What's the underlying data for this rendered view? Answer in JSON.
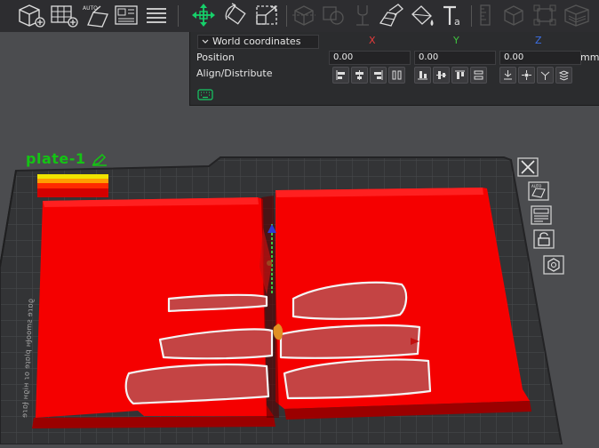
{
  "toolbar": {
    "tools": [
      {
        "name": "add-cube-icon"
      },
      {
        "name": "grid-arrange-icon"
      },
      {
        "name": "auto-orient-icon",
        "label": "AUTO"
      },
      {
        "name": "plate-layout-icon"
      },
      {
        "name": "list-objects-icon"
      },
      {
        "name": "move-icon"
      },
      {
        "name": "rotate-icon"
      },
      {
        "name": "scale-icon"
      },
      {
        "name": "cut-icon"
      },
      {
        "name": "mesh-boolean-icon"
      },
      {
        "name": "support-paint-icon"
      },
      {
        "name": "seam-paint-icon"
      },
      {
        "name": "color-paint-icon"
      },
      {
        "name": "text-icon"
      },
      {
        "name": "measure-icon"
      },
      {
        "name": "assembly-icon"
      },
      {
        "name": "brim-ears-icon"
      },
      {
        "name": "layers-icon"
      }
    ]
  },
  "gizmo": {
    "coord_label": "World coordinates",
    "axes": [
      {
        "label": "X",
        "color": "#e53b3b"
      },
      {
        "label": "Y",
        "color": "#3fc43f"
      },
      {
        "label": "Z",
        "color": "#3b6fe5"
      }
    ],
    "position_label": "Position",
    "position_values": [
      "0.00",
      "0.00",
      "0.00"
    ],
    "unit": "mm",
    "align_label": "Align/Distribute"
  },
  "plate": {
    "label": "plate-1"
  },
  "side_tools": [
    {
      "name": "close-plate-icon"
    },
    {
      "name": "auto-arrange-plate-icon"
    },
    {
      "name": "plate-settings-icon"
    },
    {
      "name": "lock-plate-icon"
    },
    {
      "name": "plate-origin-icon"
    }
  ],
  "colors": {
    "accent": "#14c414",
    "model": "#ff0000",
    "background": "#4b4c4f"
  }
}
